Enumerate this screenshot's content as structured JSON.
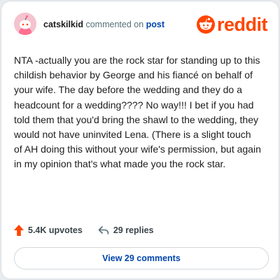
{
  "brand": {
    "name": "reddit",
    "color": "#ff4500"
  },
  "comment": {
    "author": "catskilkid",
    "action_text": "commented on",
    "link_text": "post",
    "body": "NTA -actually you are the rock star for standing up to this childish behavior by George and his fiancé on behalf of your wife. The day before the wedding and they do a headcount for a wedding???? No way!!! I bet if you had told them that you'd bring the shawl to the wedding, they would not have uninvited Lena. (There is a slight touch of AH doing this without your wife's permission, but again in my opinion that's what made you the rock star."
  },
  "stats": {
    "upvotes": "5.4K upvotes",
    "replies": "29 replies"
  },
  "cta": {
    "label": "View 29 comments"
  },
  "icons": {
    "avatar": "snoo-avatar-icon",
    "logo": "reddit-snoo-icon",
    "upvote": "upvote-arrow-icon",
    "reply": "reply-arrow-icon"
  }
}
